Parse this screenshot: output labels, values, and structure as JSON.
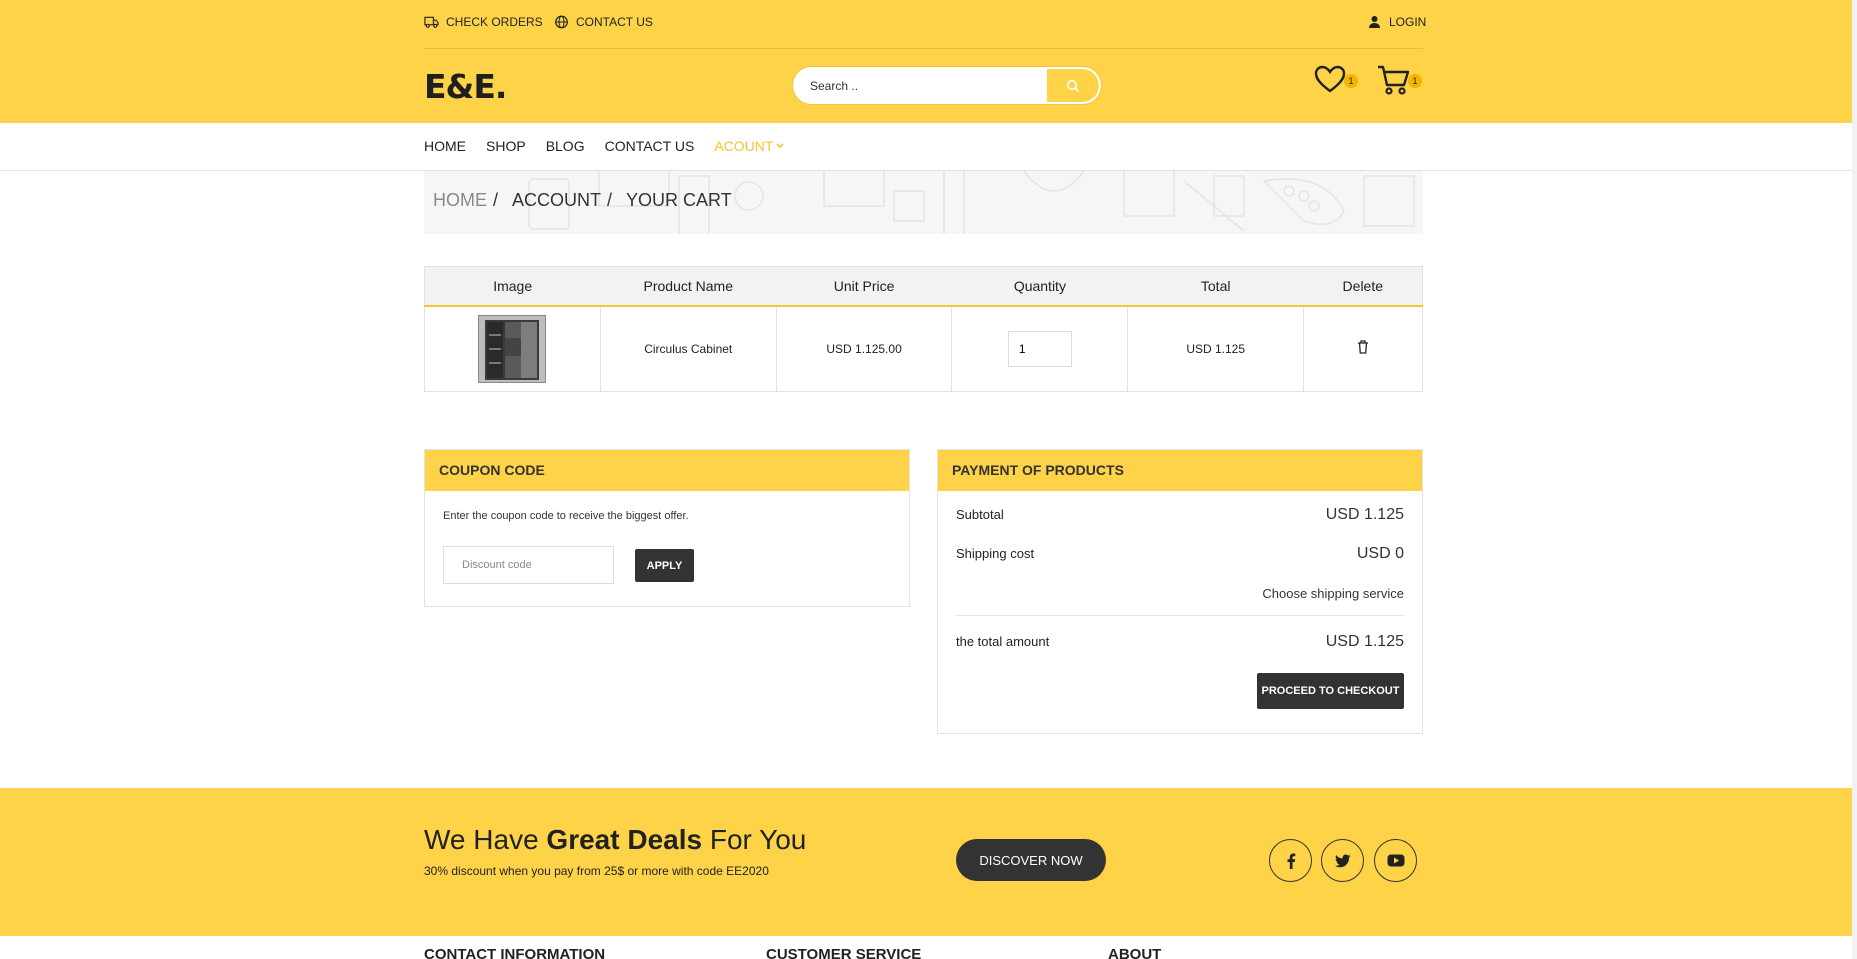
{
  "topbar": {
    "check_orders": "CHECK ORDERS",
    "contact_us": "CONTACT US",
    "login": "LOGIN"
  },
  "header": {
    "logo": "E&E.",
    "search_placeholder": "Search ..",
    "wishlist_count": "1",
    "cart_count": "1"
  },
  "nav": {
    "items": [
      "HOME",
      "SHOP",
      "BLOG",
      "CONTACT US",
      "ACOUNT"
    ],
    "active": "ACOUNT"
  },
  "breadcrumb": {
    "home": "HOME",
    "account": "ACCOUNT",
    "current": "YOUR CART",
    "separator": "/"
  },
  "cart": {
    "headers": [
      "Image",
      "Product Name",
      "Unit Price",
      "Quantity",
      "Total",
      "Delete"
    ],
    "rows": [
      {
        "product_name": "Circulus Cabinet",
        "unit_price": "USD 1.125.00",
        "quantity": "1",
        "total": "USD 1.125"
      }
    ]
  },
  "coupon": {
    "title": "COUPON CODE",
    "note": "Enter the coupon code to receive the biggest offer.",
    "placeholder": "Discount code",
    "apply": "APPLY"
  },
  "payment": {
    "title": "PAYMENT OF PRODUCTS",
    "subtotal_label": "Subtotal",
    "subtotal_value": "USD 1.125",
    "shipping_label": "Shipping cost",
    "shipping_value": "USD 0",
    "shipping_link": "Choose shipping service",
    "total_label": "the total amount",
    "total_value": "USD 1.125",
    "checkout": "PROCEED TO CHECKOUT"
  },
  "deals": {
    "title_pre": "We Have ",
    "title_bold": "Great Deals",
    "title_post": " For You",
    "subtitle": "30% discount when you pay from 25$ or more with code EE2020",
    "button": "DISCOVER NOW"
  },
  "footer": {
    "columns": [
      "CONTACT INFORMATION",
      "CUSTOMER SERVICE",
      "ABOUT"
    ]
  },
  "colors": {
    "brand_yellow": "#fed348",
    "accent": "#f5c431",
    "dark": "#333333"
  }
}
